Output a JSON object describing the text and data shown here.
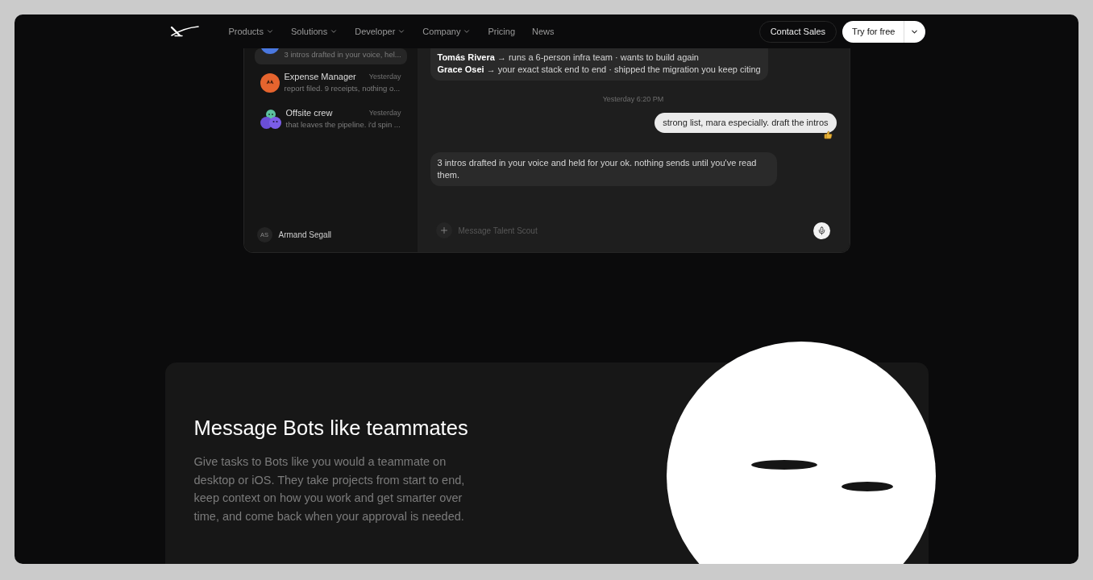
{
  "nav": {
    "items": [
      {
        "label": "Products",
        "kind": "menu"
      },
      {
        "label": "Solutions",
        "kind": "menu"
      },
      {
        "label": "Developer",
        "kind": "menu"
      },
      {
        "label": "Company",
        "kind": "menu"
      },
      {
        "label": "Pricing",
        "kind": "link"
      },
      {
        "label": "News",
        "kind": "link"
      }
    ],
    "actions": [
      {
        "label": "Contact Sales",
        "kind": "outline"
      },
      {
        "label": "Try for free",
        "kind": "split"
      }
    ]
  },
  "chat_app": {
    "sidebar": {
      "conversations": [
        {
          "preview": "3 intros drafted in your voice, hel...",
          "kind": "blue",
          "selected": true
        },
        {
          "name": "Expense Manager",
          "time": "Yesterday",
          "preview": "report filed. 9 receipts, nothing o...",
          "kind": "bot",
          "selected": false
        },
        {
          "name": "Offsite crew",
          "time": "Yesterday",
          "preview": "that leaves the pipeline. i'd spin ...",
          "kind": "group",
          "selected": false
        }
      ],
      "user": {
        "initials": "AS",
        "name": "Armand Segall"
      }
    },
    "messages": [
      {
        "kind": "bot",
        "lines": [
          "**Tomás Rivera** → runs a 6-person infra team · wants to build again",
          "**Grace Osei** → your exact stack end to end · shipped the migration you keep citing"
        ]
      },
      {
        "kind": "timestamp",
        "text": "Yesterday 6:20 PM"
      },
      {
        "kind": "user",
        "text": "strong list, mara especially. draft the intros",
        "reacted": true
      },
      {
        "kind": "bot",
        "lines": [
          "3 intros drafted in your voice and held for your ok. nothing sends until you've read them."
        ]
      }
    ],
    "composer": {
      "placeholder": "Message Talent Scout"
    }
  },
  "feature": {
    "title": "Message Bots like teammates",
    "body": "Give tasks to Bots like you would a teammate on desktop or iOS. They take projects from start to end, keep context on how you work and get smarter over time, and come back when your approval is needed."
  }
}
